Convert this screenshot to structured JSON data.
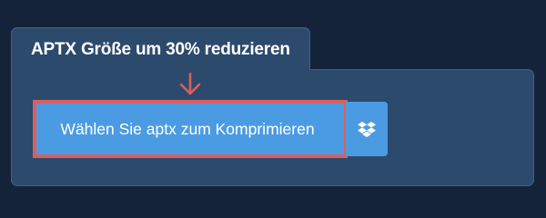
{
  "panel": {
    "title": "APTX Größe um 30% reduzieren"
  },
  "upload": {
    "button_label": "Wählen Sie aptx zum Komprimieren",
    "dropbox_icon": "dropbox-icon",
    "arrow_icon": "arrow-down-icon"
  },
  "colors": {
    "background": "#142339",
    "panel": "#2c4a6c",
    "button": "#4b9be3",
    "highlight": "#d95f5f"
  }
}
